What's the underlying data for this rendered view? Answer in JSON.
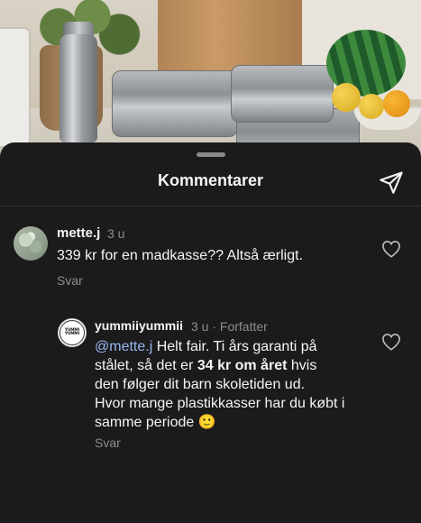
{
  "header": {
    "title": "Kommentarer",
    "send_icon": "paper-plane-icon"
  },
  "comments": [
    {
      "username": "mette.j",
      "time": "3 u",
      "text": "339 kr for en madkasse?? Altså ærligt.",
      "reply_label": "Svar",
      "like_icon": "heart-outline-icon"
    },
    {
      "username": "yummiiyummii",
      "time": "3 u",
      "author_badge": "Forfatter",
      "avatar_logo_text": "YUMMI YUMMI",
      "mention": "@mette.j",
      "text_part1": " Helt fair. Ti års garanti på",
      "text_line2_pre": "stålet, så det er ",
      "text_bold": "34 kr om året",
      "text_line2_post": " hvis",
      "text_line3": "den følger dit barn skoletiden ud.",
      "text_line4": "Hvor mange plastikkasser har du købt i",
      "text_line5": "samme periode",
      "emoji": "🙂",
      "reply_label": "Svar",
      "like_icon": "heart-outline-icon"
    }
  ],
  "colors": {
    "sheet_bg": "#1b1b1b",
    "text_primary": "#f5f5f5",
    "text_secondary": "#8e8e8e",
    "mention": "#9ab8f2"
  }
}
